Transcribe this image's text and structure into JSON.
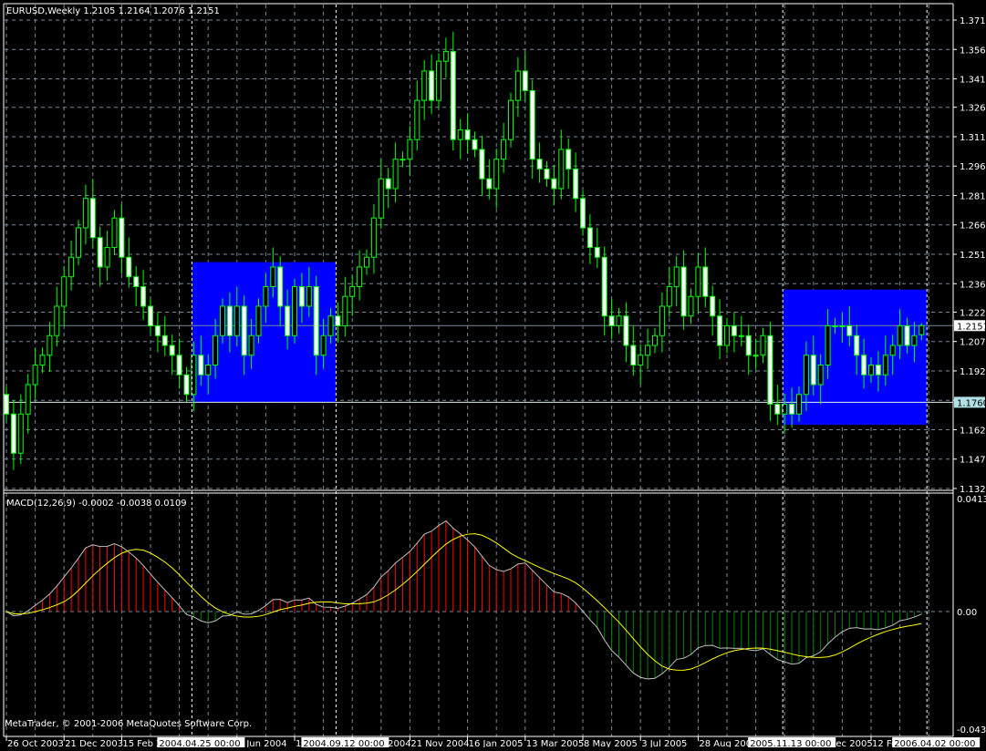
{
  "chart_data": {
    "type": "candlestick",
    "symbol_header": "EURUSD,Weekly  1.2105 1.2164 1.2076 1.2151",
    "ohlc_last": {
      "open": 1.2105,
      "high": 1.2164,
      "low": 1.2076,
      "close": 1.2151
    },
    "closes": [
      1.17,
      1.15,
      1.17,
      1.185,
      1.195,
      1.2,
      1.21,
      1.225,
      1.24,
      1.25,
      1.265,
      1.28,
      1.26,
      1.245,
      1.255,
      1.27,
      1.25,
      1.24,
      1.235,
      1.225,
      1.215,
      1.21,
      1.205,
      1.2,
      1.19,
      1.18,
      1.2,
      1.19,
      1.195,
      1.21,
      1.225,
      1.21,
      1.225,
      1.2,
      1.21,
      1.225,
      1.235,
      1.245,
      1.225,
      1.21,
      1.235,
      1.225,
      1.235,
      1.2,
      1.21,
      1.22,
      1.215,
      1.23,
      1.235,
      1.245,
      1.25,
      1.27,
      1.29,
      1.285,
      1.3,
      1.3,
      1.31,
      1.33,
      1.345,
      1.33,
      1.35,
      1.355,
      1.31,
      1.315,
      1.31,
      1.305,
      1.29,
      1.285,
      1.3,
      1.31,
      1.33,
      1.345,
      1.335,
      1.3,
      1.295,
      1.29,
      1.285,
      1.305,
      1.295,
      1.28,
      1.265,
      1.255,
      1.25,
      1.22,
      1.215,
      1.22,
      1.205,
      1.195,
      1.2,
      1.205,
      1.21,
      1.225,
      1.235,
      1.245,
      1.22,
      1.23,
      1.245,
      1.23,
      1.22,
      1.205,
      1.215,
      1.21,
      1.21,
      1.2,
      1.2,
      1.21,
      1.175,
      1.17,
      1.175,
      1.17,
      1.18,
      1.2,
      1.185,
      1.195,
      1.215,
      1.215,
      1.215,
      1.21,
      1.2,
      1.19,
      1.195,
      1.19,
      1.2,
      1.205,
      1.215,
      1.205,
      1.21,
      1.2151
    ],
    "price_axis": {
      "min": 1.132,
      "max": 1.371,
      "ticks": [
        "1.3710",
        "1.3560",
        "1.3410",
        "1.3265",
        "1.3115",
        "1.2965",
        "1.2815",
        "1.2665",
        "1.2515",
        "1.2365",
        "1.2220",
        "1.2070",
        "1.1920",
        "1.1770",
        "1.1620",
        "1.1470",
        "1.1320"
      ]
    },
    "price_markers": [
      {
        "label": "1.2151",
        "value": 1.2151,
        "line_color": "#778899",
        "bg": "#FFFFFF"
      },
      {
        "label": "1.1760",
        "value": 1.176,
        "line_color": "#E0F0F0",
        "bg": "#B0E0E6"
      }
    ],
    "rectangles": [
      {
        "from_bar": 26,
        "to_bar": 46,
        "top": 1.2475,
        "bottom": 1.176,
        "color": "#0000FF"
      },
      {
        "from_bar": 108,
        "to_bar": 128,
        "top": 1.2335,
        "bottom": 1.1645,
        "color": "#0000FF"
      }
    ],
    "vertical_lines": [
      {
        "bar": 26,
        "label": "2004.04.25 00:00"
      },
      {
        "bar": 46,
        "label": "2004.09.12 00:00"
      },
      {
        "bar": 108,
        "label": "2005.11.13 00:00"
      },
      {
        "bar": 128,
        "label": "2006.04.02 00:00"
      }
    ],
    "time_labels": [
      {
        "bar": 0,
        "label": "26 Oct 2003"
      },
      {
        "bar": 8,
        "label": "21 Dec 2003"
      },
      {
        "bar": 16,
        "label": "15 Feb 2004"
      },
      {
        "bar": 32,
        "label": "6 Jun 2004"
      },
      {
        "bar": 40,
        "label": "1 Aug 2004"
      },
      {
        "bar": 48,
        "label": "26 Sep 2004"
      },
      {
        "bar": 56,
        "label": "21 Nov 2004"
      },
      {
        "bar": 64,
        "label": "16 Jan 2005"
      },
      {
        "bar": 72,
        "label": "13 Mar 2005"
      },
      {
        "bar": 80,
        "label": "8 May 2005"
      },
      {
        "bar": 88,
        "label": "3 Jul 2005"
      },
      {
        "bar": 96,
        "label": "28 Aug 2005"
      },
      {
        "bar": 112,
        "label": "18 Dec 2005"
      },
      {
        "bar": 120,
        "label": "12 Feb 2006"
      }
    ],
    "macd": {
      "header": "MACD(12,26,9) -0.0002 -0.0038 0.0109",
      "params": [
        12,
        26,
        9
      ],
      "axis": {
        "min": -0.043,
        "max": 0.0413,
        "ticks": [
          "0.0413",
          "0.00",
          "-0.043"
        ]
      },
      "colors": {
        "macd_line": "#C0C0C0",
        "signal_line": "#FFFF00",
        "hist_pos": "#FF0000",
        "hist_neg": "#008000"
      }
    },
    "colors": {
      "background": "#000000",
      "grid": "#778899",
      "candle": "#00FF00",
      "bull_fill": "#000000",
      "bear_fill": "#FFFFFF"
    }
  },
  "footer": {
    "copyright": "MetaTrader, © 2001-2006 MetaQuotes Software Corp."
  }
}
